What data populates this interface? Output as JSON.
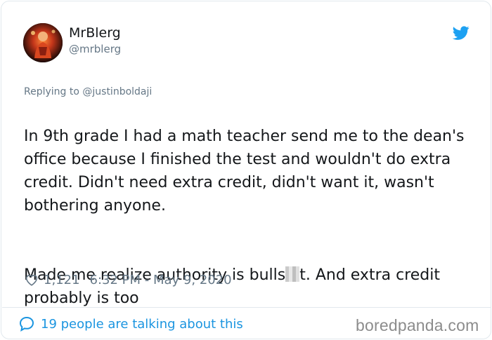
{
  "tweet": {
    "display_name": "MrBlerg",
    "handle": "@mrblerg",
    "reply_prefix": "Replying to",
    "reply_to": "@justinboldaji",
    "text_p1": "In 9th grade I had a math teacher send me to the dean's office because I finished the test and wouldn't do extra credit. Didn't need extra credit, didn't want it, wasn't bothering anyone.",
    "text_p2_before": "Made me realize authority is bulls",
    "text_p2_after": "t. And extra credit probably is too",
    "likes": "1,121",
    "timestamp": "6:32 PM - May 9, 2020",
    "conversation": "19 people are talking about this"
  },
  "icons": {
    "logo": "twitter-bird-icon",
    "like": "heart-icon",
    "reply": "speech-bubble-icon"
  },
  "watermark": "boredpanda.com",
  "colors": {
    "twitter_blue": "#1da1f2",
    "link_blue": "#1b95e0",
    "text": "#14171a",
    "secondary": "#657786",
    "border": "#e1e8ed"
  }
}
